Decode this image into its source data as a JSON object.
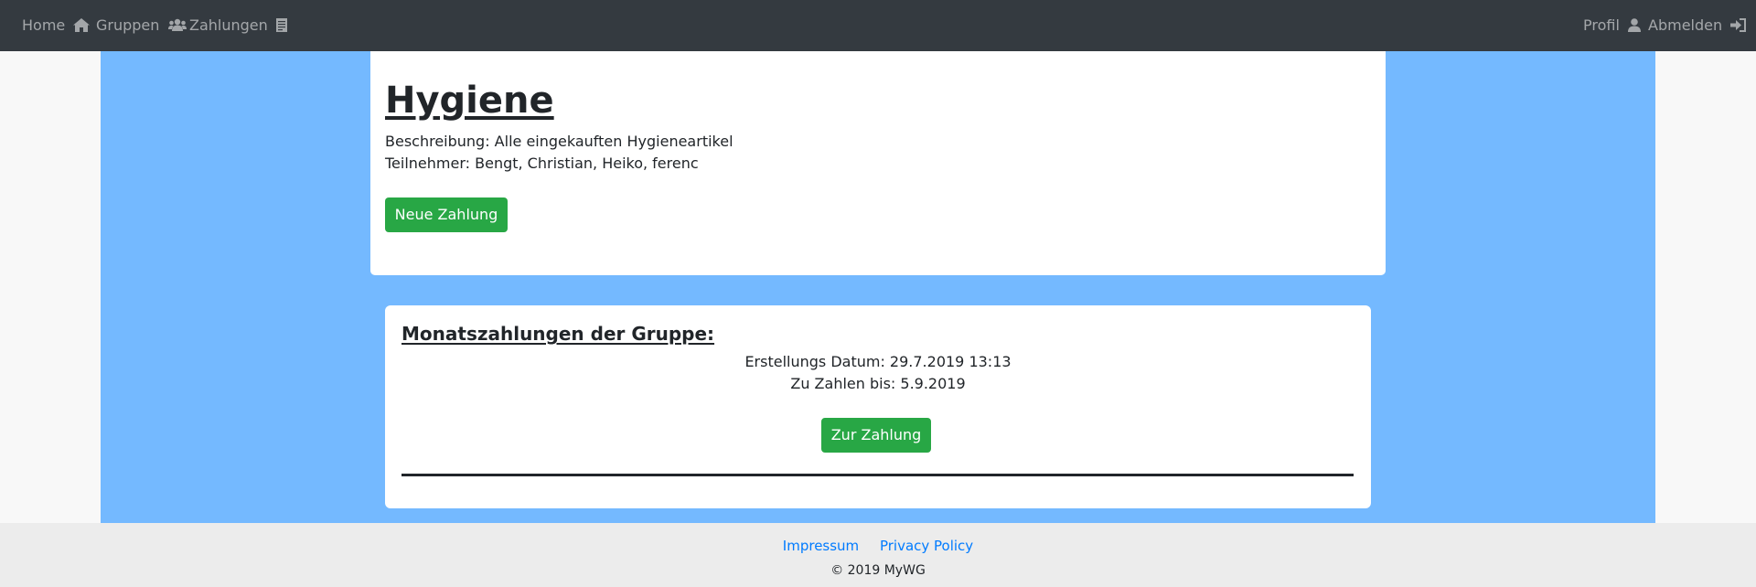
{
  "nav": {
    "home_label": "Home",
    "groups_label": "Gruppen",
    "payments_label": "Zahlungen",
    "profile_label": "Profil",
    "logout_label": "Abmelden",
    "icons": {
      "home": "home-icon",
      "groups": "users-icon",
      "payments": "receipt-icon",
      "profile": "user-icon",
      "logout": "sign-in-icon"
    }
  },
  "group": {
    "title": "Hygiene",
    "description": "Beschreibung: Alle eingekauften Hygieneartikel",
    "participants": "Teilnehmer: Bengt, Christian, Heiko, ferenc",
    "new_payment_label": "Neue Zahlung"
  },
  "monthly": {
    "heading": "Monatszahlungen der Gruppe:",
    "created": "Erstellungs Datum: 29.7.2019 13:13",
    "due": "Zu Zahlen bis: 5.9.2019",
    "pay_label": "Zur Zahlung"
  },
  "footer": {
    "impressum": "Impressum",
    "privacy": "Privacy Policy",
    "copyright": "© 2019 MyWG"
  },
  "colors": {
    "navbar": "#343a40",
    "nav_text": "#9a9da0",
    "background_blue": "#74b9ff",
    "button_green": "#28a745",
    "link_blue": "#007bff",
    "footer_bg": "#ececec"
  }
}
